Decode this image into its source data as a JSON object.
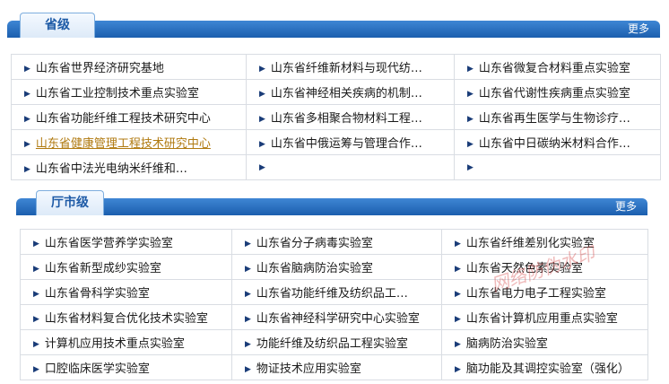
{
  "sections": [
    {
      "tab_label": "省级",
      "more_label": "更多",
      "rows": [
        [
          "山东省世界经济研究基地",
          "山东省纤维新材料与现代纺…",
          "山东省微复合材料重点实验室"
        ],
        [
          "山东省工业控制技术重点实验室",
          "山东省神经相关疾病的机制…",
          "山东省代谢性疾病重点实验室"
        ],
        [
          "山东省功能纤维工程技术研究中心",
          "山东省多相聚合物材料工程…",
          "山东省再生医学与生物诊疗…"
        ],
        [
          "山东省健康管理工程技术研究中心",
          "山东省中俄运筹与管理合作…",
          "山东省中日碳纳米材料合作…"
        ],
        [
          "山东省中法光电纳米纤维和…",
          "",
          ""
        ]
      ],
      "highlighted": "山东省健康管理工程技术研究中心"
    },
    {
      "tab_label": "厅市级",
      "more_label": "更多",
      "rows": [
        [
          "山东省医学营养学实验室",
          "山东省分子病毒实验室",
          "山东省纤维差别化实验室"
        ],
        [
          "山东省新型成纱实验室",
          "山东省脑病防治实验室",
          "山东省天然色素实验室"
        ],
        [
          "山东省骨科学实验室",
          "山东省功能纤维及纺织品工…",
          "山东省电力电子工程实验室"
        ],
        [
          "山东省材料复合优化技术实验室",
          "山东省神经科学研究中心实验室",
          "山东省计算机应用重点实验室"
        ],
        [
          "计算机应用技术重点实验室",
          "功能纤维及纺织品工程实验室",
          "脑病防治实验室"
        ],
        [
          "口腔临床医学实验室",
          "物证技术应用实验室",
          "脑功能及其调控实验室（强化）"
        ]
      ]
    }
  ],
  "stamp_text": "网络防伪水印",
  "colors": {
    "header_bar": "#1b5fae",
    "tab_text": "#1d5aa6",
    "highlight": "#b07a10",
    "grid_border": "#d9dde3"
  }
}
